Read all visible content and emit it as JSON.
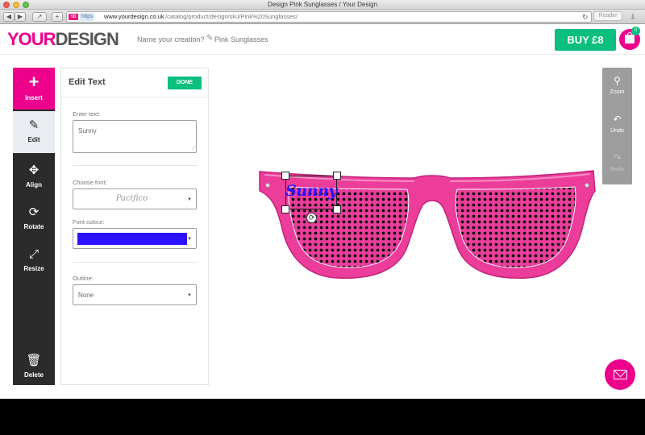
{
  "browser": {
    "window_title": "Design Pink Sunglasses / Your Design",
    "favicon": "YD",
    "url_scheme": "https",
    "url_host": "www.yourdesign.co.uk",
    "url_path": "/catalog/product/design/sku/Pink%20Sunglasses/",
    "reader_label": "Reader",
    "icons": [
      "back-icon",
      "forward-icon",
      "share-icon",
      "new-tab-icon",
      "reload-icon",
      "download-icon"
    ]
  },
  "header": {
    "logo_your": "YOUR",
    "logo_design": "DESIGN",
    "name_prompt": "Name your creation?",
    "creation_name": "Pink Sunglasses",
    "buy_label": "BUY £8",
    "basket_count": "0"
  },
  "tools": {
    "insert": "Insert",
    "edit": "Edit",
    "align": "Align",
    "rotate": "Rotate",
    "resize": "Resize",
    "delete": "Delete"
  },
  "edit_panel": {
    "title": "Edit Text",
    "done_label": "DONE",
    "text_label": "Enter text:",
    "text_value": "Sunny",
    "font_label": "Choose font:",
    "font_value": "Pacifico",
    "colour_label": "Font colour:",
    "colour_value": "#2d12ff",
    "outline_label": "Outline:",
    "outline_value": "None"
  },
  "canvas": {
    "design_text": "Sunny",
    "frame_color": "#ec3d9b"
  },
  "right_tools": {
    "zoom": "Zoom",
    "undo": "Undo",
    "redo": "Redo"
  },
  "colors": {
    "brand_pink": "#ec008c",
    "buy_green": "#0bbf7e",
    "rail_dark": "#2b2b2b"
  }
}
